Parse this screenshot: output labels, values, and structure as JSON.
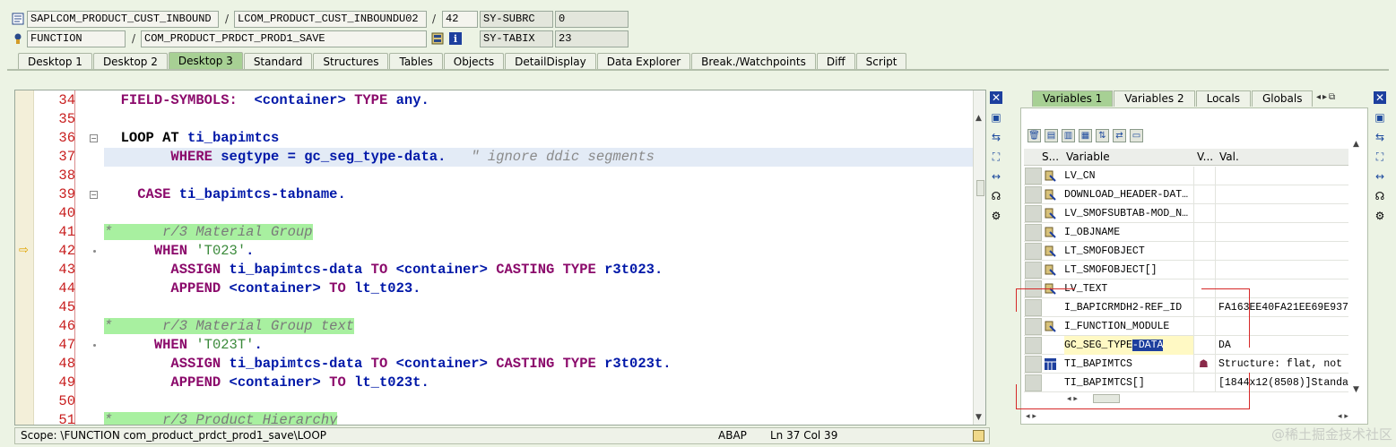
{
  "header": {
    "row1": {
      "program": "SAPLCOM_PRODUCT_CUST_INBOUND",
      "include": "LCOM_PRODUCT_CUST_INBOUNDU02",
      "line": "42",
      "var_name": "SY-SUBRC",
      "var_value": "0"
    },
    "row2": {
      "type": "FUNCTION",
      "name": "COM_PRODUCT_PRDCT_PROD1_SAVE",
      "var_name": "SY-TABIX",
      "var_value": "23"
    }
  },
  "tabs": [
    "Desktop 1",
    "Desktop 2",
    "Desktop 3",
    "Standard",
    "Structures",
    "Tables",
    "Objects",
    "DetailDisplay",
    "Data Explorer",
    "Break./Watchpoints",
    "Diff",
    "Script"
  ],
  "active_tab": "Desktop 3",
  "editor": {
    "lines": [
      {
        "num": "34",
        "segments": [
          {
            "t": "  ",
            "c": ""
          },
          {
            "t": "FIELD-SYMBOLS:",
            "c": "kw"
          },
          {
            "t": "  <container> ",
            "c": "kw2"
          },
          {
            "t": "TYPE",
            "c": "kw"
          },
          {
            "t": " any.",
            "c": "kw2"
          }
        ]
      },
      {
        "num": "35",
        "segments": []
      },
      {
        "num": "36",
        "segments": [
          {
            "t": "  ",
            "c": ""
          },
          {
            "t": "LOOP AT",
            "c": "kwb"
          },
          {
            "t": " ti_bapimtcs",
            "c": "kw2"
          }
        ]
      },
      {
        "num": "37",
        "segments": [
          {
            "t": "        ",
            "c": ""
          },
          {
            "t": "WHERE",
            "c": "kw"
          },
          {
            "t": " segtype = gc_seg_type-data.   ",
            "c": "kw2"
          },
          {
            "t": "\" ignore ddic segments",
            "c": "cmt"
          }
        ]
      },
      {
        "num": "38",
        "segments": []
      },
      {
        "num": "39",
        "segments": [
          {
            "t": "    ",
            "c": ""
          },
          {
            "t": "CASE",
            "c": "kw"
          },
          {
            "t": " ti_bapimtcs-tabname.",
            "c": "kw2"
          }
        ]
      },
      {
        "num": "40",
        "segments": []
      },
      {
        "num": "41",
        "segments": [
          {
            "t": "*      r/3 Material Group",
            "c": "cmt-bg"
          }
        ]
      },
      {
        "num": "42",
        "segments": [
          {
            "t": "      ",
            "c": ""
          },
          {
            "t": "WHEN",
            "c": "kw"
          },
          {
            "t": " ",
            "c": ""
          },
          {
            "t": "'T023'",
            "c": "str"
          },
          {
            "t": ".",
            "c": "kw2"
          }
        ]
      },
      {
        "num": "43",
        "segments": [
          {
            "t": "        ",
            "c": ""
          },
          {
            "t": "ASSIGN",
            "c": "kw"
          },
          {
            "t": " ti_bapimtcs-data ",
            "c": "kw2"
          },
          {
            "t": "TO",
            "c": "kw"
          },
          {
            "t": " <container> ",
            "c": "kw2"
          },
          {
            "t": "CASTING TYPE",
            "c": "kw"
          },
          {
            "t": " r3t023.",
            "c": "kw2"
          }
        ]
      },
      {
        "num": "44",
        "segments": [
          {
            "t": "        ",
            "c": ""
          },
          {
            "t": "APPEND",
            "c": "kw"
          },
          {
            "t": " <container> ",
            "c": "kw2"
          },
          {
            "t": "TO",
            "c": "kw"
          },
          {
            "t": " lt_t023.",
            "c": "kw2"
          }
        ]
      },
      {
        "num": "45",
        "segments": []
      },
      {
        "num": "46",
        "segments": [
          {
            "t": "*      r/3 Material Group text",
            "c": "cmt-bg"
          }
        ]
      },
      {
        "num": "47",
        "segments": [
          {
            "t": "      ",
            "c": ""
          },
          {
            "t": "WHEN",
            "c": "kw"
          },
          {
            "t": " ",
            "c": ""
          },
          {
            "t": "'T023T'",
            "c": "str"
          },
          {
            "t": ".",
            "c": "kw2"
          }
        ]
      },
      {
        "num": "48",
        "segments": [
          {
            "t": "        ",
            "c": ""
          },
          {
            "t": "ASSIGN",
            "c": "kw"
          },
          {
            "t": " ti_bapimtcs-data ",
            "c": "kw2"
          },
          {
            "t": "TO",
            "c": "kw"
          },
          {
            "t": " <container> ",
            "c": "kw2"
          },
          {
            "t": "CASTING TYPE",
            "c": "kw"
          },
          {
            "t": " r3t023t.",
            "c": "kw2"
          }
        ]
      },
      {
        "num": "49",
        "segments": [
          {
            "t": "        ",
            "c": ""
          },
          {
            "t": "APPEND",
            "c": "kw"
          },
          {
            "t": " <container> ",
            "c": "kw2"
          },
          {
            "t": "TO",
            "c": "kw"
          },
          {
            "t": " lt_t023t.",
            "c": "kw2"
          }
        ]
      },
      {
        "num": "50",
        "segments": []
      },
      {
        "num": "51",
        "segments": [
          {
            "t": "*      r/3 Product Hierarchy",
            "c": "cmt-bg"
          }
        ]
      }
    ]
  },
  "status": {
    "scope": "Scope: \\FUNCTION com_product_prdct_prod1_save\\LOOP",
    "lang": "ABAP",
    "position": "Ln  37 Col  39"
  },
  "right_panel": {
    "tabs": [
      "Variables 1",
      "Variables 2",
      "Locals",
      "Globals"
    ],
    "active_tab": "Variables 1",
    "headers": {
      "s": "S...",
      "variable": "Variable",
      "v": "V...",
      "val": "Val."
    },
    "rows": [
      {
        "name": "LV_CN",
        "icon": "var",
        "value": ""
      },
      {
        "name": "DOWNLOAD_HEADER-DAT…",
        "icon": "var",
        "value": ""
      },
      {
        "name": "LV_SMOFSUBTAB-MOD_N…",
        "icon": "var",
        "value": ""
      },
      {
        "name": "I_OBJNAME",
        "icon": "var",
        "value": ""
      },
      {
        "name": "LT_SMOFOBJECT",
        "icon": "var",
        "value": ""
      },
      {
        "name": "LT_SMOFOBJECT[]",
        "icon": "var",
        "value": ""
      },
      {
        "name": "LV_TEXT",
        "icon": "var",
        "value": ""
      },
      {
        "name": "I_BAPICRMDH2-REF_ID",
        "icon": "",
        "value": "FA163EE40FA21EE69E937"
      },
      {
        "name": "I_FUNCTION_MODULE",
        "icon": "var",
        "value": ""
      },
      {
        "name": "GC_SEG_TYPE-DATA",
        "icon": "",
        "value": "DA"
      },
      {
        "name": "TI_BAPIMTCS",
        "icon": "table",
        "value": "Structure: flat, not"
      },
      {
        "name": "TI_BAPIMTCS[]",
        "icon": "",
        "value": "[1844x12(8508)]Standa"
      }
    ]
  },
  "watermark": "@稀土掘金技术社区"
}
